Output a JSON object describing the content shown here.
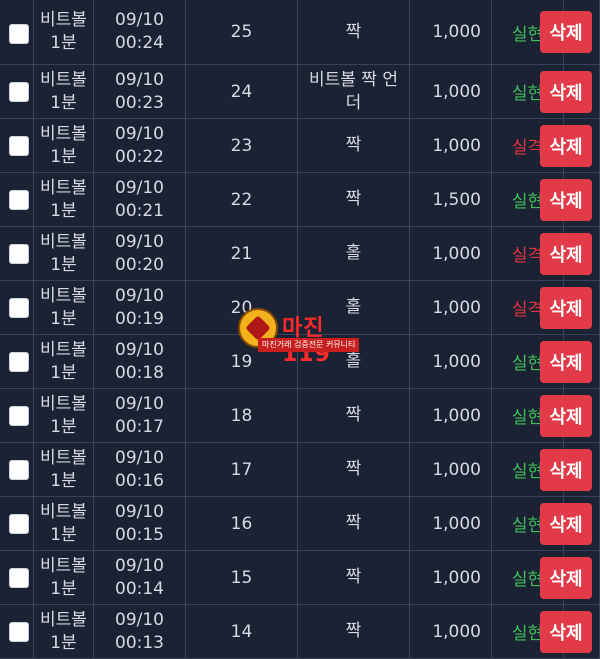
{
  "labels": {
    "delete": "삭제"
  },
  "colors": {
    "win": "#3fbf5a",
    "lose": "#e0353f",
    "delete_bg": "#e23a48"
  },
  "rows": [
    {
      "game": [
        "비트볼",
        "1분"
      ],
      "time": [
        "09/10",
        "00:24"
      ],
      "round": "25",
      "pick": [
        "짝"
      ],
      "amount": "1,000",
      "result": "실현",
      "status": "win"
    },
    {
      "game": [
        "비트볼",
        "1분"
      ],
      "time": [
        "09/10",
        "00:23"
      ],
      "round": "24",
      "pick": [
        "비트볼 짝 언",
        "더"
      ],
      "amount": "1,000",
      "result": "실현",
      "status": "win"
    },
    {
      "game": [
        "비트볼",
        "1분"
      ],
      "time": [
        "09/10",
        "00:22"
      ],
      "round": "23",
      "pick": [
        "짝"
      ],
      "amount": "1,000",
      "result": "실격",
      "status": "lose"
    },
    {
      "game": [
        "비트볼",
        "1분"
      ],
      "time": [
        "09/10",
        "00:21"
      ],
      "round": "22",
      "pick": [
        "짝"
      ],
      "amount": "1,500",
      "result": "실현",
      "status": "win"
    },
    {
      "game": [
        "비트볼",
        "1분"
      ],
      "time": [
        "09/10",
        "00:20"
      ],
      "round": "21",
      "pick": [
        "홀"
      ],
      "amount": "1,000",
      "result": "실격",
      "status": "lose"
    },
    {
      "game": [
        "비트볼",
        "1분"
      ],
      "time": [
        "09/10",
        "00:19"
      ],
      "round": "20",
      "pick": [
        "홀"
      ],
      "amount": "1,000",
      "result": "실격",
      "status": "lose"
    },
    {
      "game": [
        "비트볼",
        "1분"
      ],
      "time": [
        "09/10",
        "00:18"
      ],
      "round": "19",
      "pick": [
        "홀"
      ],
      "amount": "1,000",
      "result": "실현",
      "status": "win"
    },
    {
      "game": [
        "비트볼",
        "1분"
      ],
      "time": [
        "09/10",
        "00:17"
      ],
      "round": "18",
      "pick": [
        "짝"
      ],
      "amount": "1,000",
      "result": "실현",
      "status": "win"
    },
    {
      "game": [
        "비트볼",
        "1분"
      ],
      "time": [
        "09/10",
        "00:16"
      ],
      "round": "17",
      "pick": [
        "짝"
      ],
      "amount": "1,000",
      "result": "실현",
      "status": "win"
    },
    {
      "game": [
        "비트볼",
        "1분"
      ],
      "time": [
        "09/10",
        "00:15"
      ],
      "round": "16",
      "pick": [
        "짝"
      ],
      "amount": "1,000",
      "result": "실현",
      "status": "win"
    },
    {
      "game": [
        "비트볼",
        "1분"
      ],
      "time": [
        "09/10",
        "00:14"
      ],
      "round": "15",
      "pick": [
        "짝"
      ],
      "amount": "1,000",
      "result": "실현",
      "status": "win"
    },
    {
      "game": [
        "비트볼",
        "1분"
      ],
      "time": [
        "09/10",
        "00:13"
      ],
      "round": "14",
      "pick": [
        "짝"
      ],
      "amount": "1,000",
      "result": "실현",
      "status": "win"
    }
  ],
  "watermark": {
    "title": "마진",
    "suffix": "119",
    "subtitle": "마진거래 검증전문 커뮤니티"
  }
}
